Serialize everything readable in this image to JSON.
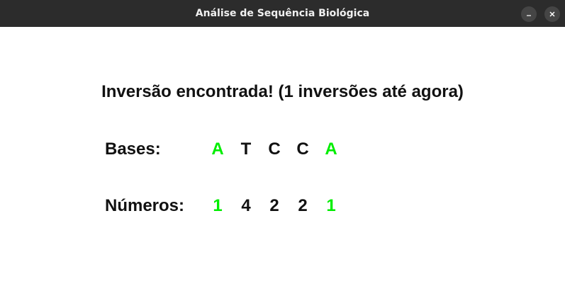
{
  "window": {
    "title": "Análise de Sequência Biológica",
    "minimize_glyph": "minimize-icon",
    "close_glyph": "close-icon"
  },
  "colors": {
    "highlight": "#00ee00",
    "text": "#111111",
    "titlebar": "#2c2c2c"
  },
  "message": "Inversão encontrada! (1 inversões até agora)",
  "bases": {
    "label": "Bases:",
    "items": [
      {
        "value": "A",
        "highlight": true
      },
      {
        "value": "T",
        "highlight": false
      },
      {
        "value": "C",
        "highlight": false
      },
      {
        "value": "C",
        "highlight": false
      },
      {
        "value": "A",
        "highlight": true
      }
    ]
  },
  "numbers": {
    "label": "Números:",
    "items": [
      {
        "value": "1",
        "highlight": true
      },
      {
        "value": "4",
        "highlight": false
      },
      {
        "value": "2",
        "highlight": false
      },
      {
        "value": "2",
        "highlight": false
      },
      {
        "value": "1",
        "highlight": true
      }
    ]
  }
}
